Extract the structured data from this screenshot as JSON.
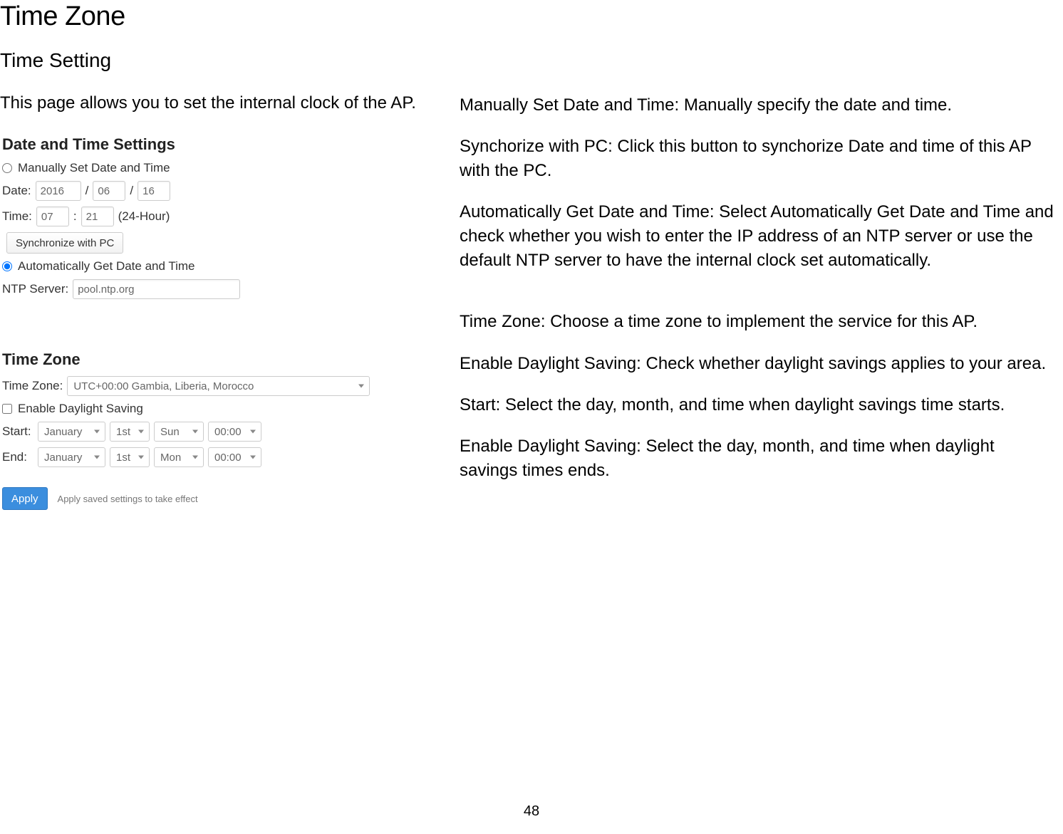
{
  "headings": {
    "main": "Time Zone",
    "sub": "Time Setting"
  },
  "left": {
    "intro": "This page allows you to set the internal clock of the AP."
  },
  "panel": {
    "dts_title": "Date and Time Settings",
    "manual_label": "Manually Set Date and Time",
    "date_label": "Date:",
    "date_year": "2016",
    "date_month": "06",
    "date_day": "16",
    "slash": "/",
    "time_label": "Time:",
    "time_hour": "07",
    "time_min": "21",
    "time_suffix": "(24-Hour)",
    "colon": ":",
    "sync_button": "Synchronize with PC",
    "auto_label": "Automatically Get Date and Time",
    "ntp_label": "NTP Server:",
    "ntp_value": "pool.ntp.org",
    "tz_title": "Time Zone",
    "tz_label": "Time Zone:",
    "tz_value": "UTC+00:00 Gambia, Liberia, Morocco",
    "dls_label": "Enable Daylight Saving",
    "start_label": "Start:",
    "end_label": "End:",
    "dls_start": {
      "month": "January",
      "ord": "1st",
      "day": "Sun",
      "time": "00:00"
    },
    "dls_end": {
      "month": "January",
      "ord": "1st",
      "day": "Mon",
      "time": "00:00"
    },
    "apply_button": "Apply",
    "apply_note": "Apply saved settings to take effect"
  },
  "right": {
    "p1": "Manually Set Date and Time: Manually specify the date and time.",
    "p2": "Synchorize with PC: Click this button to synchorize Date and time of this AP with the PC.",
    "p3": "Automatically Get Date and Time: Select Automatically Get Date and Time and check whether you wish to enter the IP address of an NTP server or use the default NTP server to have the internal clock set automatically.",
    "p4": "Time Zone: Choose a time zone to implement the service for this AP.",
    "p5": "Enable Daylight Saving: Check whether daylight savings applies to your area.",
    "p6": "Start: Select the day, month, and time when daylight savings time starts.",
    "p7": "Enable Daylight Saving: Select the day, month, and time when daylight savings times ends."
  },
  "page_number": "48"
}
